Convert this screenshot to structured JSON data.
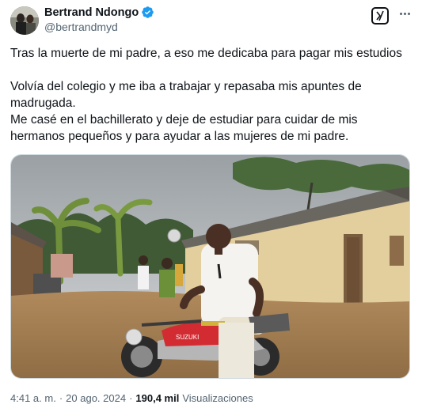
{
  "author": {
    "name": "Bertrand Ndongo",
    "handle": "@bertrandmyd",
    "verified": true,
    "verified_color": "#1d9bf0"
  },
  "actions": {
    "grok_icon": "grok-icon",
    "more_icon": "more-options-icon"
  },
  "tweet": {
    "paragraph_1": "Tras la muerte de mi padre, a eso me dedicaba para pagar mis estudios",
    "paragraph_2_line_1": "Volvía del colegio y me iba a trabajar y repasaba mis apuntes de madrugada.",
    "paragraph_2_line_2": "Me casé en el bachillerato y deje de estudiar para cuidar de mis hermanos pequeños y para ayudar a las mujeres de mi padre."
  },
  "meta": {
    "time": "4:41 a. m.",
    "separator_1": "·",
    "date": "20 ago. 2024",
    "separator_2": "·",
    "views_count": "190,4 mil",
    "views_label": "Visualizaciones"
  },
  "media": {
    "motorcycle_brand": "SUZUKI"
  }
}
